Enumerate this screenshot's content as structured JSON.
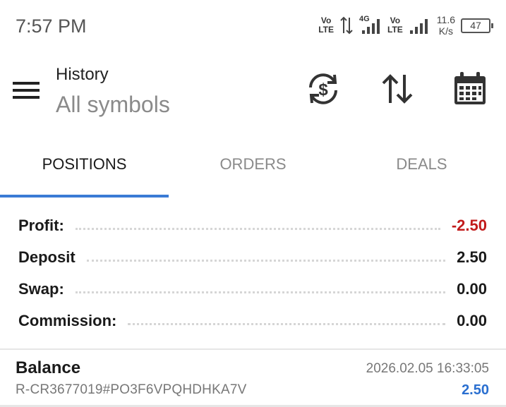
{
  "status_bar": {
    "time": "7:57 PM",
    "volte1": "Vo\nLTE",
    "net": "4G",
    "volte2": "Vo\nLTE",
    "speed_value": "11.6",
    "speed_unit": "K/s",
    "battery": "47"
  },
  "header": {
    "title": "History",
    "subtitle": "All symbols",
    "icons": [
      "menu-icon",
      "currency-exchange-icon",
      "sort-icon",
      "calendar-icon"
    ]
  },
  "tabs": [
    {
      "label": "POSITIONS",
      "active": true
    },
    {
      "label": "ORDERS",
      "active": false
    },
    {
      "label": "DEALS",
      "active": false
    }
  ],
  "summary": {
    "profit_label": "Profit:",
    "profit_value": "-2.50",
    "deposit_label": "Deposit",
    "deposit_value": "2.50",
    "swap_label": "Swap:",
    "swap_value": "0.00",
    "commission_label": "Commission:",
    "commission_value": "0.00"
  },
  "deal": {
    "type": "Balance",
    "comment": "R-CR3677019#PO3F6VPQHDHKA7V",
    "time": "2026.02.05 16:33:05",
    "amount": "2.50"
  },
  "colors": {
    "accent": "#3a7bd5",
    "negative": "#c21b1b",
    "positive_blue": "#2a6fd0"
  }
}
